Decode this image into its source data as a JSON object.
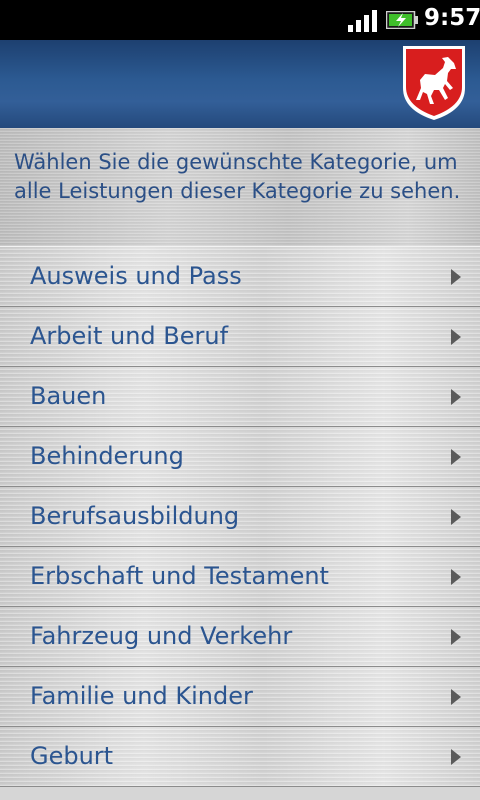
{
  "status_bar": {
    "time": "9:57",
    "signal_bars": 4,
    "battery_charging": true,
    "signal_icon": "signal-bars-icon",
    "battery_icon": "battery-charging-icon"
  },
  "header": {
    "crest_icon": "lower-saxony-horse-crest-icon",
    "colors": {
      "header_blue": "#2c5a92",
      "crest_red": "#d81e1e"
    }
  },
  "intro": {
    "text": "Wählen Sie die gewünschte Kategorie, um alle Leistungen dieser Kategorie zu sehen."
  },
  "categories": [
    {
      "label": "Ausweis und Pass"
    },
    {
      "label": "Arbeit und Beruf"
    },
    {
      "label": "Bauen"
    },
    {
      "label": "Behinderung"
    },
    {
      "label": "Berufsausbildung"
    },
    {
      "label": "Erbschaft und Testament"
    },
    {
      "label": "Fahrzeug und Verkehr"
    },
    {
      "label": "Familie und Kinder"
    },
    {
      "label": "Geburt"
    }
  ],
  "chevron_icon": "chevron-right-icon",
  "text_color": "#2b5590"
}
